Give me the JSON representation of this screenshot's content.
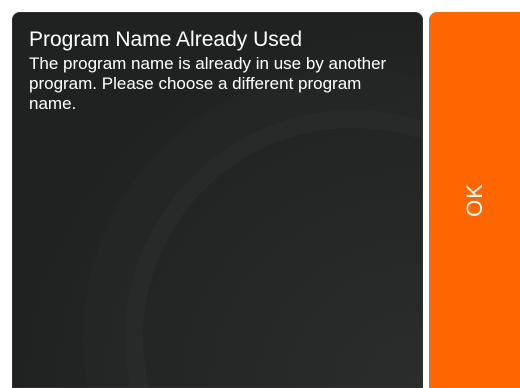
{
  "dialog": {
    "title": "Program Name Already Used",
    "message": "The program name is already in use by another program. Please choose a different program name."
  },
  "buttons": {
    "ok_label": "OK"
  },
  "colors": {
    "accent": "#ff6600",
    "dialog_background": "#232525",
    "text": "#ffffff"
  }
}
